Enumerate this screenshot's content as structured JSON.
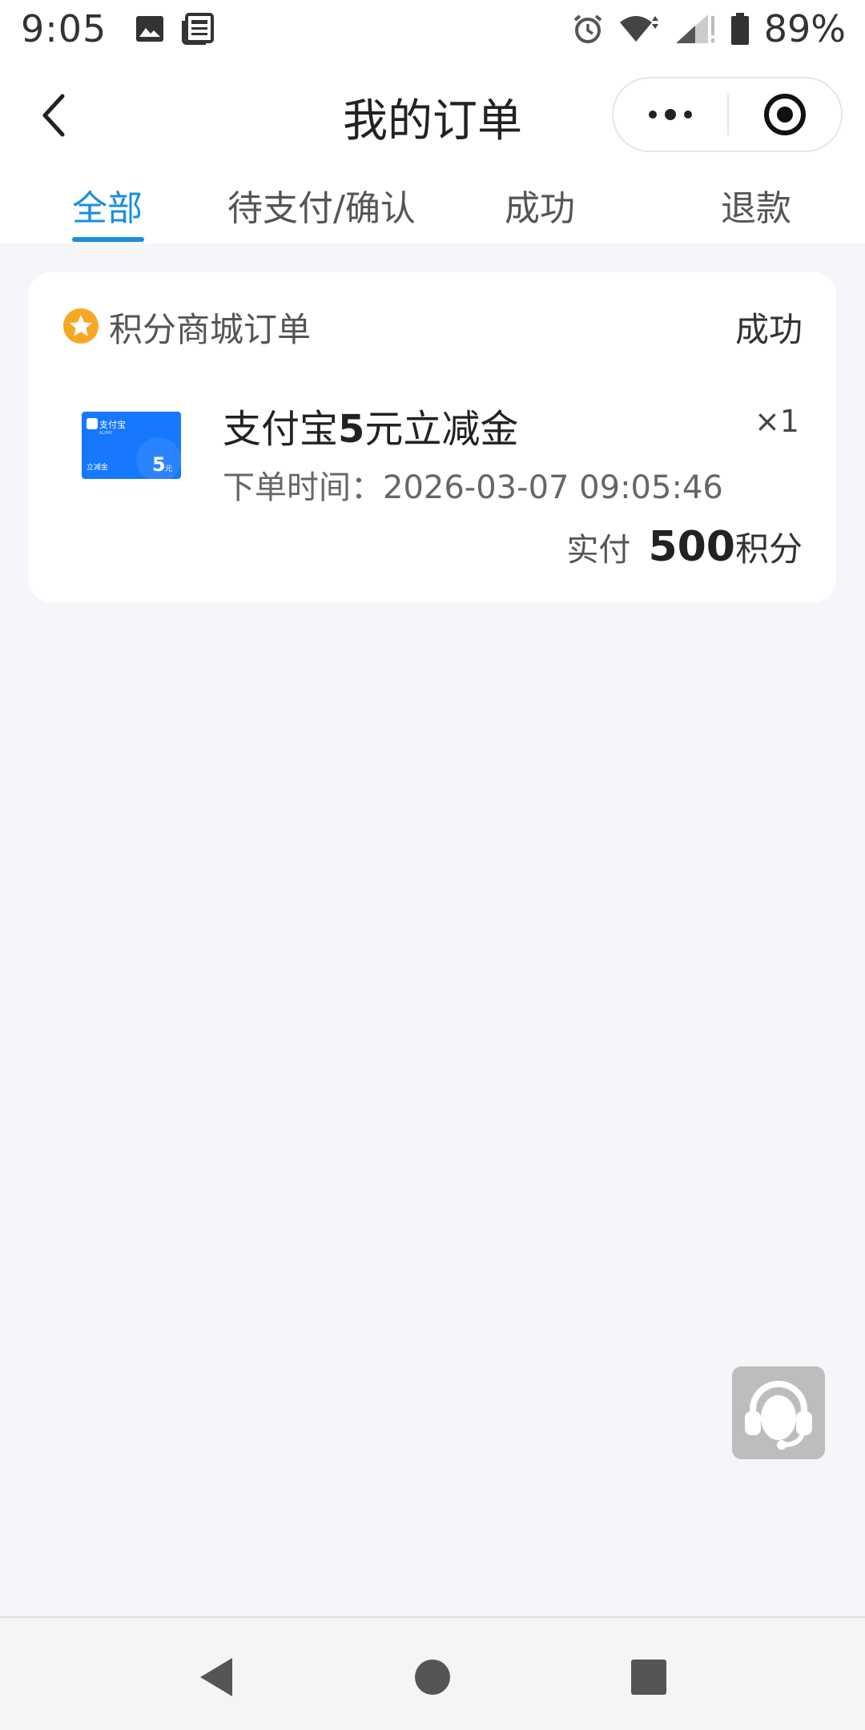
{
  "status_bar": {
    "time": "9:05",
    "battery": "89%",
    "icons": [
      "image-icon",
      "news-icon",
      "alarm-icon",
      "wifi-icon",
      "signal-icon",
      "battery-icon"
    ]
  },
  "header": {
    "title": "我的订单",
    "back_icon": "chevron-left-icon",
    "more_icon": "more-dots-icon",
    "close_icon": "target-close-icon"
  },
  "tabs": [
    {
      "label": "全部",
      "active": true
    },
    {
      "label": "待支付/确认",
      "active": false
    },
    {
      "label": "成功",
      "active": false
    },
    {
      "label": "退款",
      "active": false
    }
  ],
  "order": {
    "source": "积分商城订单",
    "source_icon": "star-badge-icon",
    "status": "成功",
    "thumb": {
      "brand": "支付宝",
      "brand_sub": "ALIPAY",
      "tag": "立减金",
      "amount": "5",
      "unit": "元"
    },
    "product_prefix": "支付宝",
    "product_amount": "5",
    "product_suffix": "元立减金",
    "quantity": "×1",
    "time_label": "下单时间：",
    "time_value": "2026-03-07 09:05:46",
    "pay_label": "实付",
    "pay_amount": "500",
    "pay_unit": "积分"
  },
  "support_icon": "headset-icon",
  "nav": [
    "back-triangle-icon",
    "home-circle-icon",
    "recents-square-icon"
  ],
  "colors": {
    "accent": "#1a8ee0",
    "background": "#f5f6fa",
    "star_badge": "#f7a823",
    "alipay_blue": "#1677ff"
  }
}
